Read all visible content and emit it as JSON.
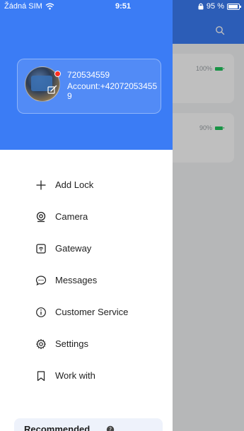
{
  "status_bar": {
    "carrier": "Žádná SIM",
    "time": "9:51",
    "battery": "95 %"
  },
  "background": {
    "cards": [
      {
        "battery": "100%"
      },
      {
        "battery": "90%"
      }
    ]
  },
  "profile": {
    "name": "720534559",
    "account": "Account:+420720534559"
  },
  "menu": [
    {
      "label": "Add Lock",
      "icon": "plus-icon"
    },
    {
      "label": "Camera",
      "icon": "camera-icon"
    },
    {
      "label": "Gateway",
      "icon": "gateway-icon"
    },
    {
      "label": "Messages",
      "icon": "message-icon"
    },
    {
      "label": "Customer Service",
      "icon": "info-icon"
    },
    {
      "label": "Settings",
      "icon": "gear-icon"
    },
    {
      "label": "Work with",
      "icon": "bookmark-icon"
    }
  ],
  "recommended": {
    "label": "Recommended"
  },
  "colors": {
    "primary": "#3b7cf5",
    "battery_green": "#22c55e"
  }
}
